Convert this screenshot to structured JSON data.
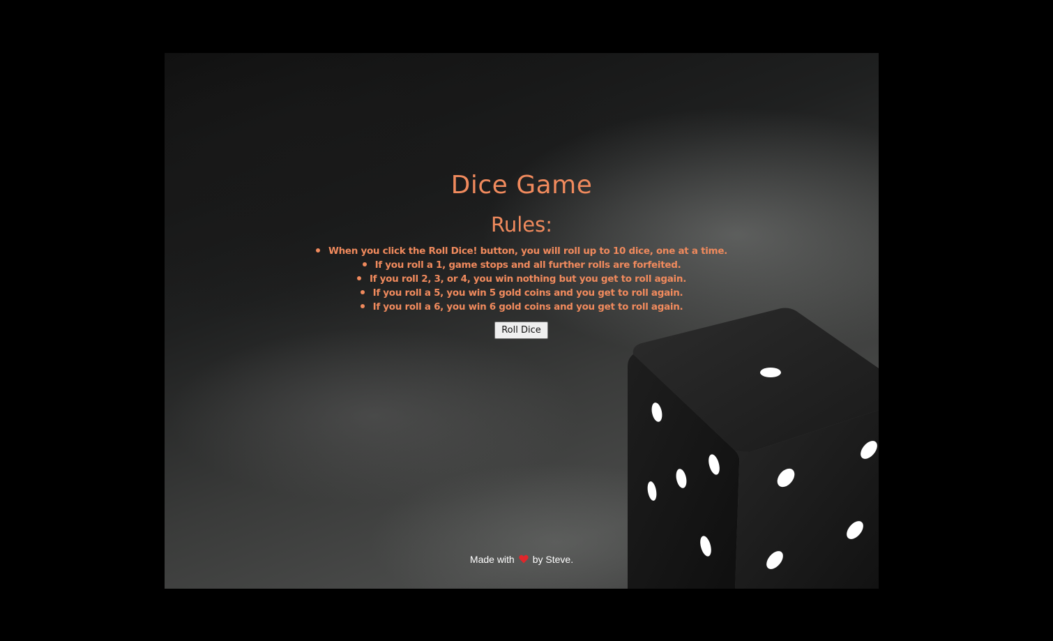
{
  "game": {
    "title": "Dice Game",
    "rules_heading": "Rules:",
    "rules": [
      "When you click the Roll Dice! button, you will roll up to 10 dice, one at a time.",
      "If you roll a 1, game stops and all further rolls are forfeited.",
      "If you roll 2, 3, or 4, you win nothing but you get to roll again.",
      "If you roll a 5, you win 5 gold coins and you get to roll again.",
      "If you roll a 6, you win 6 gold coins and you get to roll again."
    ],
    "roll_button_label": "Roll Dice"
  },
  "footer": {
    "made_with": "Made with",
    "heart_icon": "heart-icon",
    "by": "by Steve."
  },
  "colors": {
    "accent": "#f08a5d",
    "heart": "#e0262b"
  }
}
